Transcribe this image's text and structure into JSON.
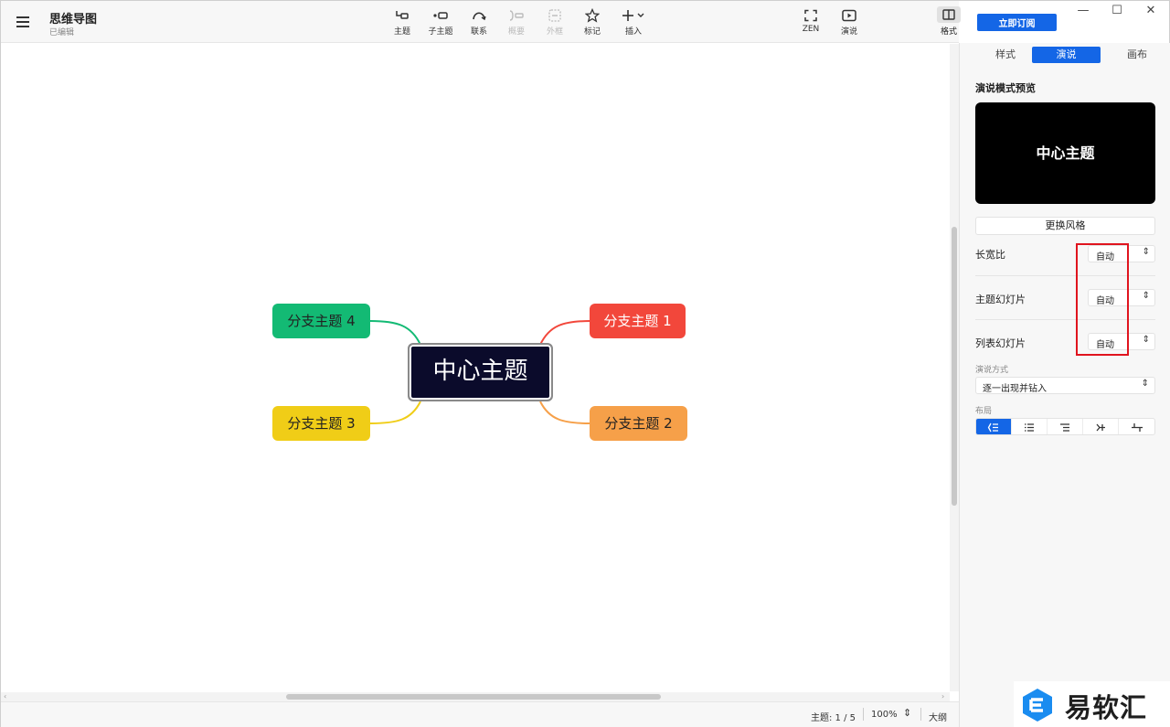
{
  "header": {
    "title": "思维导图",
    "status": "已编辑"
  },
  "toolbar": {
    "topic": "主题",
    "subtopic": "子主题",
    "relationship": "联系",
    "summary": "概要",
    "boundary": "外框",
    "marker": "标记",
    "insert": "插入",
    "zen": "ZEN",
    "present": "演说",
    "format": "格式"
  },
  "subscribe": "立即订阅",
  "window": {
    "minimize": "—",
    "maximize": "☐",
    "close": "✕"
  },
  "map": {
    "central": "中心主题",
    "branch1": "分支主题 1",
    "branch2": "分支主题 2",
    "branch3": "分支主题 3",
    "branch4": "分支主题 4"
  },
  "statusbar": {
    "topics": "主题: 1 / 5",
    "zoom": "100%",
    "outline": "大纲"
  },
  "panel": {
    "tabs": [
      "样式",
      "演说",
      "画布"
    ],
    "preview_title": "演说模式预览",
    "preview_text": "中心主题",
    "style_button": "更换风格",
    "aspect_label": "长宽比",
    "aspect_value": "自动",
    "topic_slide_label": "主题幻灯片",
    "topic_slide_value": "自动",
    "list_slide_label": "列表幻灯片",
    "list_slide_value": "自动",
    "mode_label": "演说方式",
    "mode_value": "逐一出现并钻入",
    "layout_label": "布局"
  },
  "colors": {
    "accent": "#1466e6",
    "branch1": "#f2473b",
    "branch2": "#f6a049",
    "branch3": "#f0cd17",
    "branch4": "#13ba74",
    "central": "#0b0b2b",
    "highlight": "#e0141e"
  },
  "watermark": {
    "text": "易软汇"
  }
}
